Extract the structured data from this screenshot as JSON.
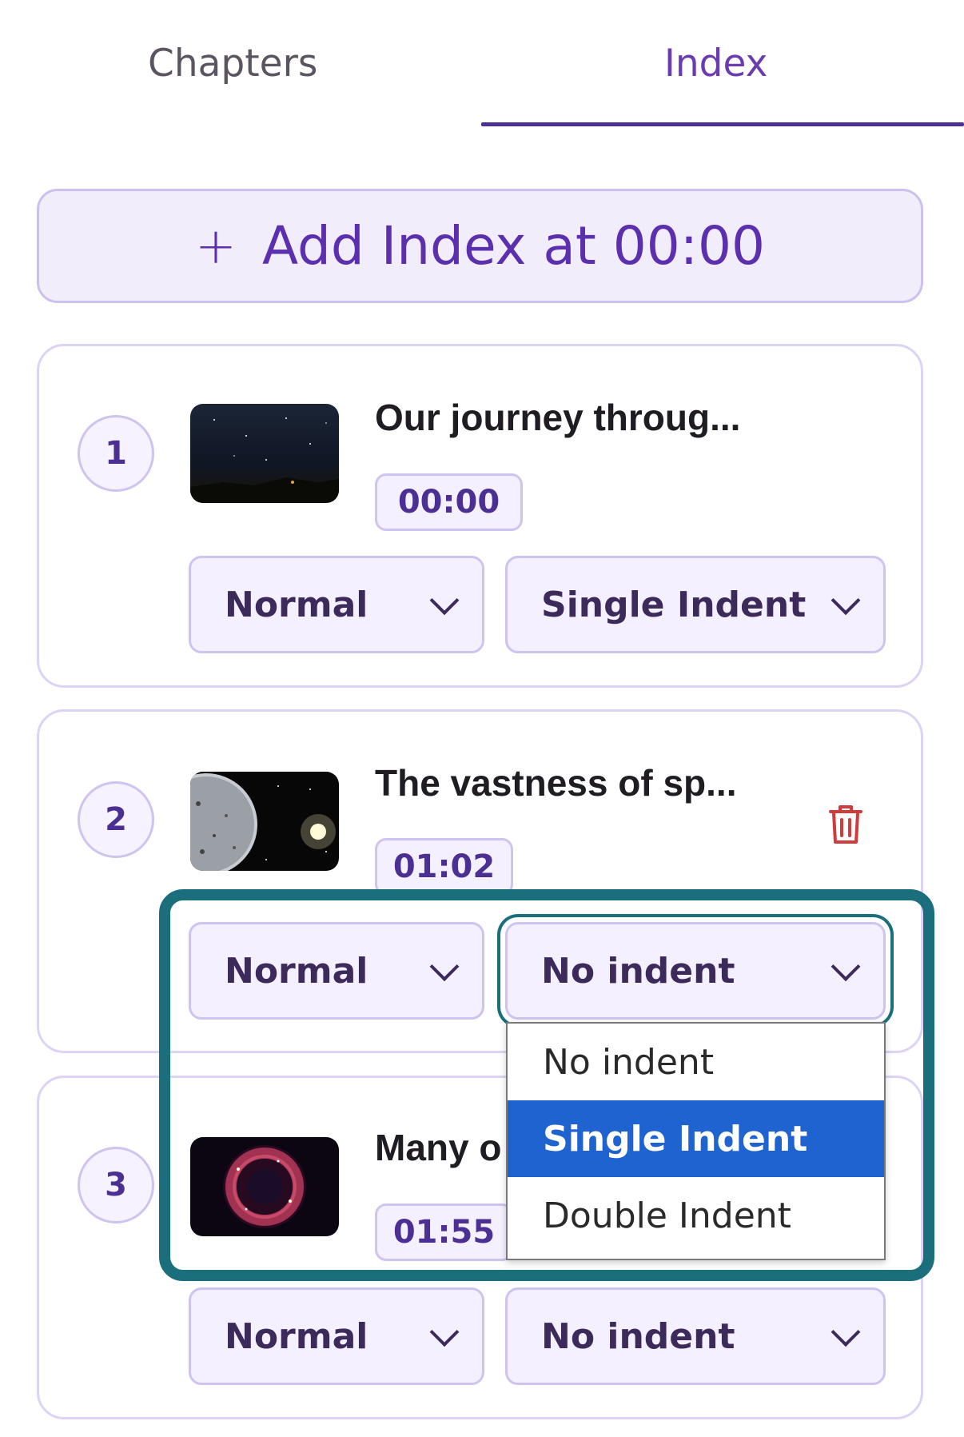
{
  "tabs": [
    {
      "label": "Chapters",
      "active": false
    },
    {
      "label": "Index",
      "active": true
    }
  ],
  "add_button": {
    "icon": "+",
    "label": "Add Index at 00:00"
  },
  "entries": [
    {
      "number": "1",
      "title": "Our journey throug...",
      "time": "00:00",
      "style": "Normal",
      "indent": "Single Indent",
      "thumbnail": "night-sky-landscape"
    },
    {
      "number": "2",
      "title": "The vastness of sp...",
      "time": "01:02",
      "style": "Normal",
      "indent": "No indent",
      "thumbnail": "planet-and-star"
    },
    {
      "number": "3",
      "title": "Many o",
      "time": "01:55",
      "style": "Normal",
      "indent": "No indent",
      "thumbnail": "red-nebula-ring"
    }
  ],
  "dropdown": {
    "options": [
      "No indent",
      "Single Indent",
      "Double Indent"
    ],
    "highlighted": "Single Indent"
  },
  "colors": {
    "accent": "#4b2f93",
    "highlight_box": "#1b6f7c",
    "option_selected": "#1f63d0",
    "delete": "#d23b3b"
  }
}
